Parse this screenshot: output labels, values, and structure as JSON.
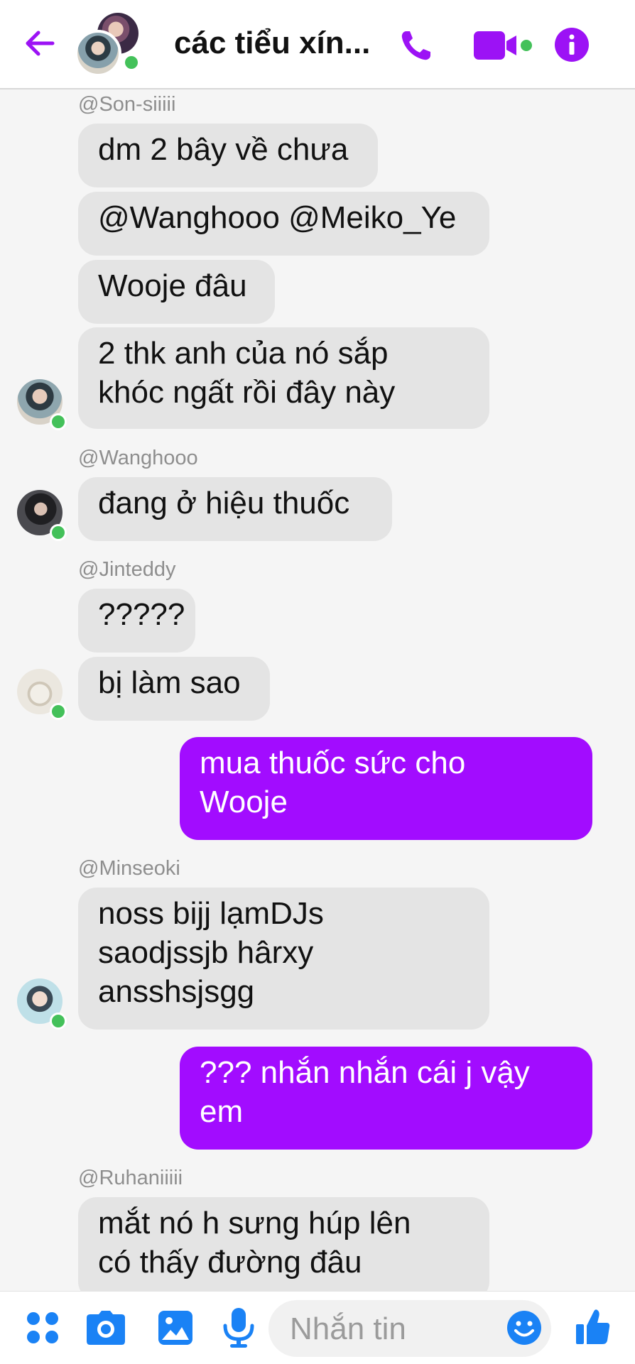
{
  "header": {
    "title": "các tiểu xín...",
    "accent_color": "#9c12f5",
    "icons": [
      "back-arrow-icon",
      "phone-icon",
      "video-camera-icon",
      "info-icon"
    ]
  },
  "messages": [
    {
      "sender": "@Son-siiiii",
      "bubbles": [
        "dm 2 bây về chưa",
        "@Wanghooo @Meiko_Ye",
        "Wooje đâu",
        "2 thk anh của nó sắp\nkhóc ngất rồi đây này"
      ]
    },
    {
      "sender": "@Wanghooo",
      "bubbles": [
        "đang ở hiệu thuốc"
      ]
    },
    {
      "sender": "@Jinteddy",
      "bubbles": [
        "?????",
        "bị làm sao"
      ]
    },
    {
      "sender": "me",
      "bubbles": [
        "mua thuốc sức cho\nWooje"
      ]
    },
    {
      "sender": "@Minseoki",
      "bubbles": [
        "noss bijj lạmDJs\nsaodjssjb hârxy\nansshsjsgg"
      ]
    },
    {
      "sender": "me",
      "bubbles": [
        "??? nhắn nhắn cái j vậy\nem"
      ]
    },
    {
      "sender": "@Ruhaniiiii",
      "bubbles": [
        "mắt nó h sưng húp lên\ncó thấy đường đâu"
      ]
    }
  ],
  "composer": {
    "placeholder": "Nhắn tin",
    "icons": [
      "apps-grid-icon",
      "camera-icon",
      "image-icon",
      "microphone-icon",
      "emoji-icon",
      "thumbs-up-icon"
    ]
  }
}
